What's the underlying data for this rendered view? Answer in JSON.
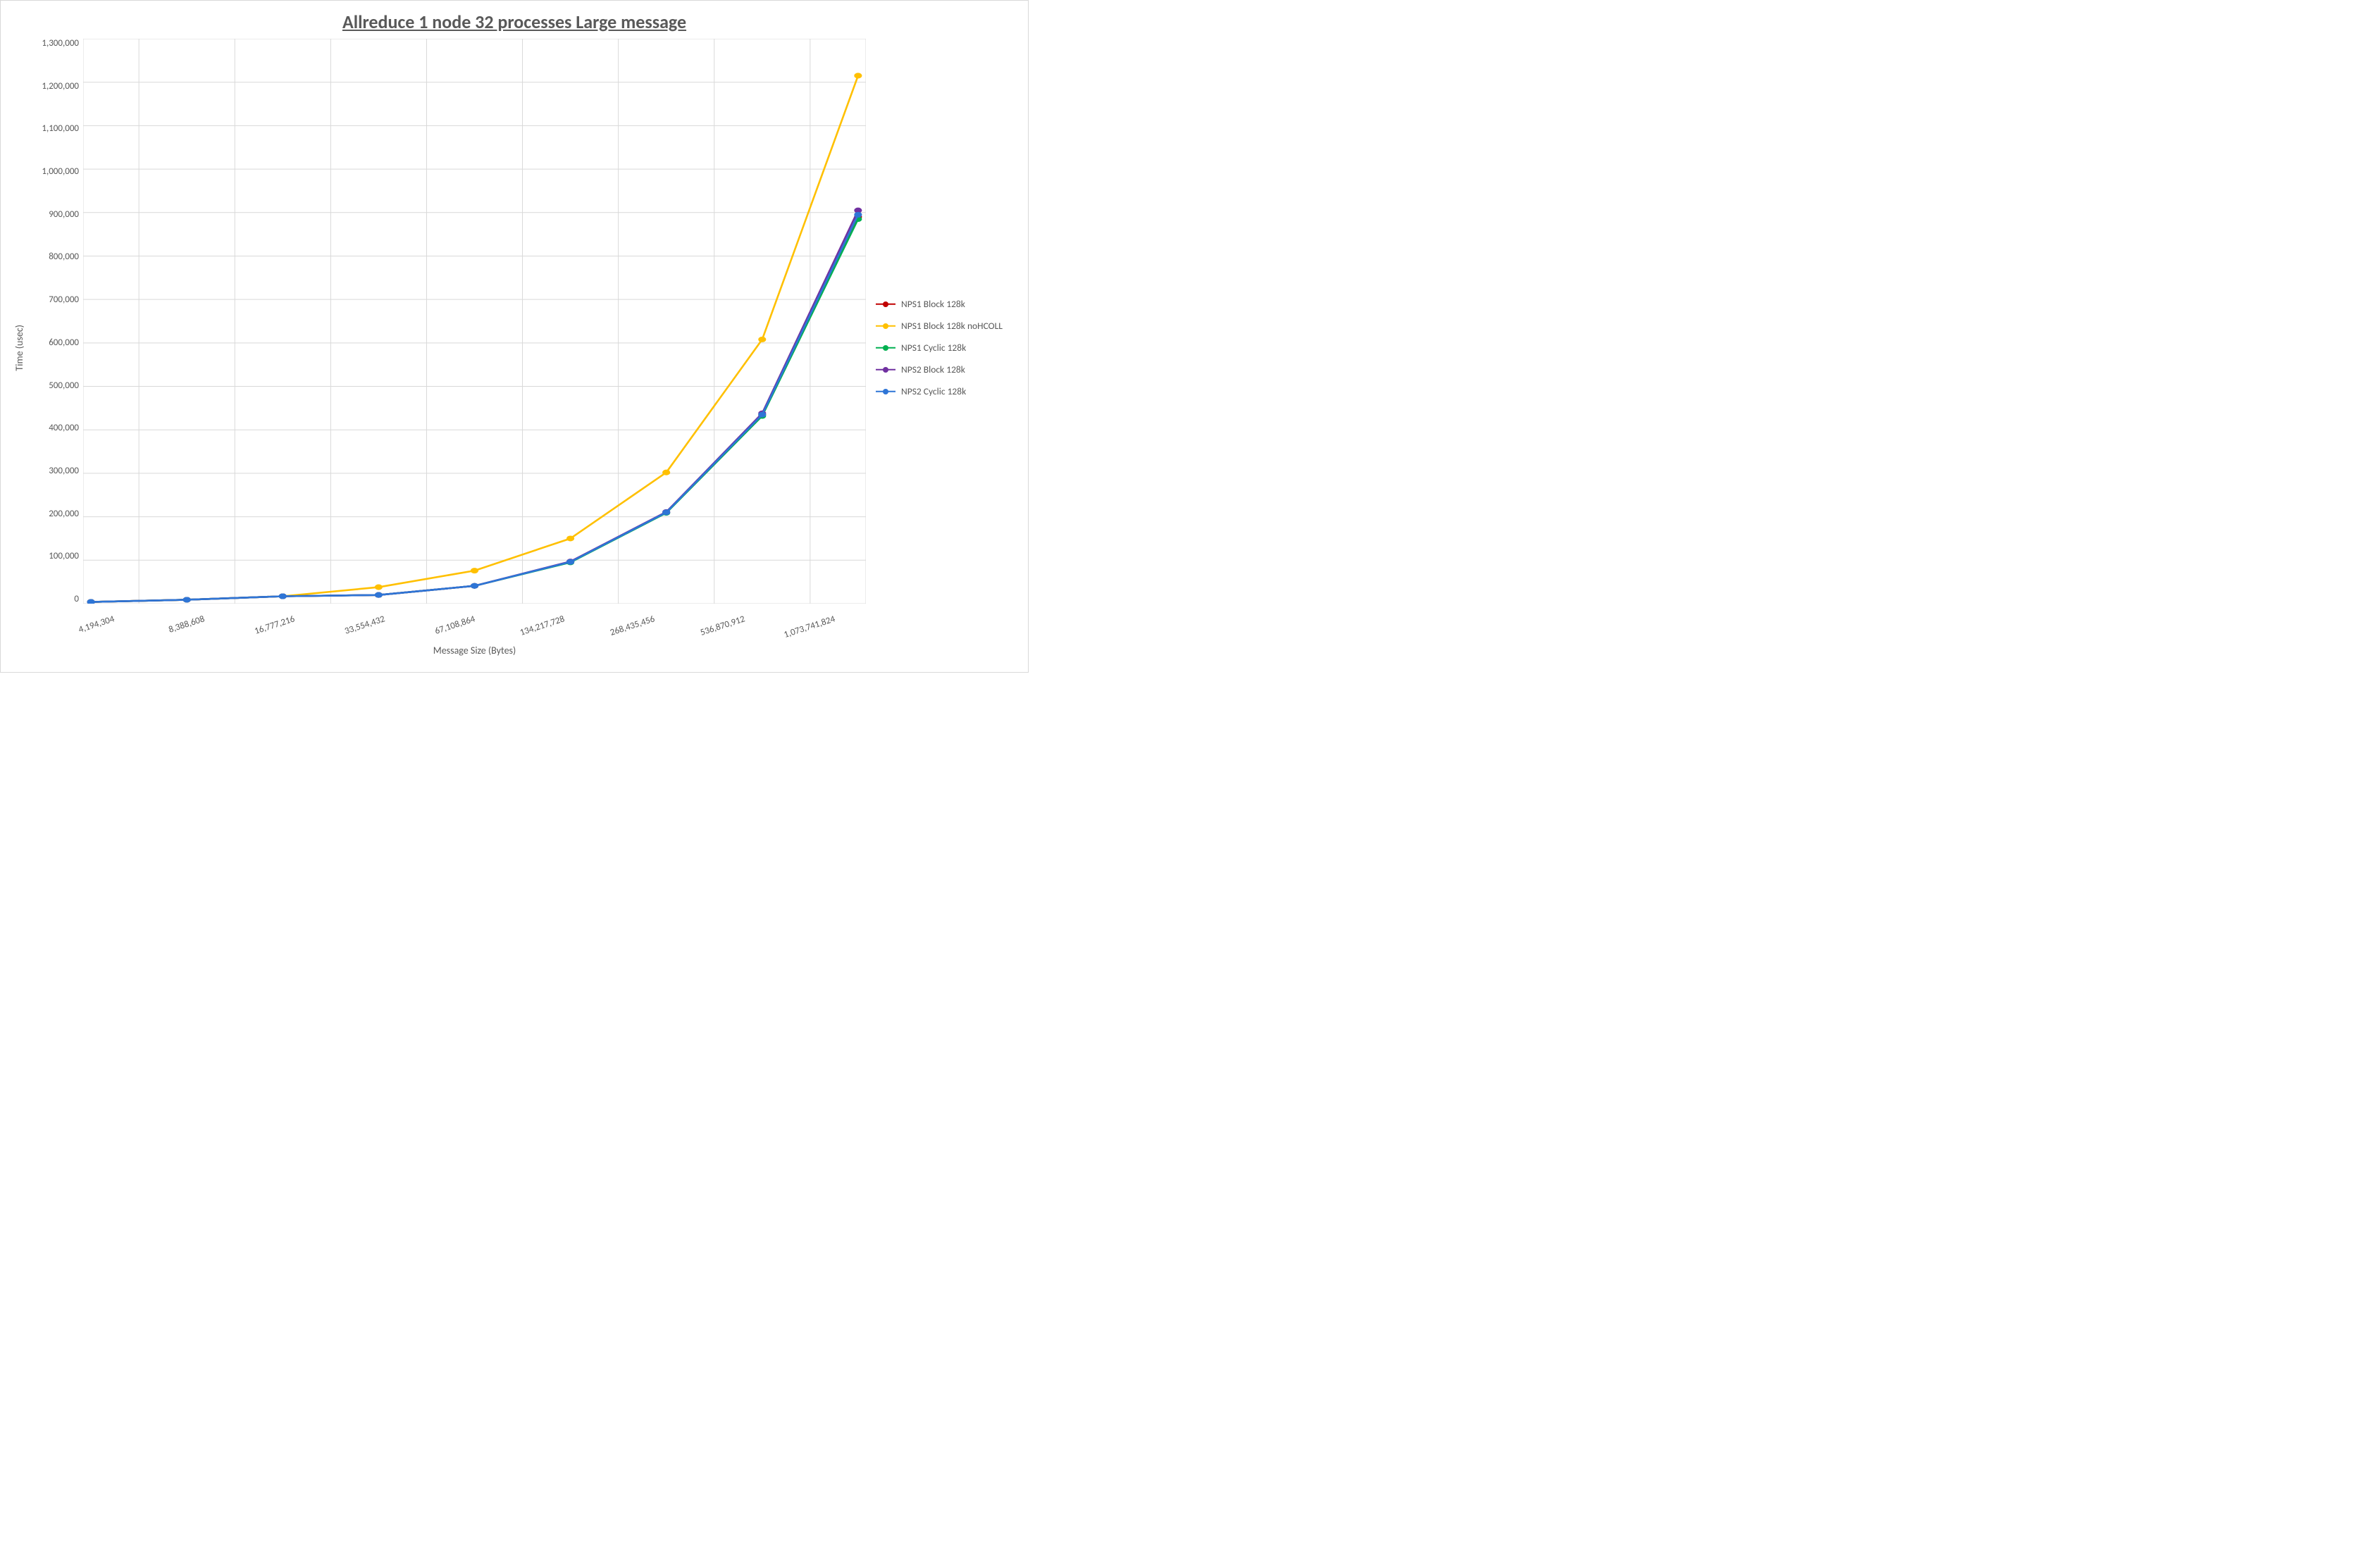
{
  "chart_data": {
    "type": "line",
    "title": "Allreduce 1 node 32 processes Large message",
    "xlabel": "Message Size (Bytes)",
    "ylabel": "Time (usec)",
    "ylim": [
      0,
      1300000
    ],
    "y_ticks": [
      "1,300,000",
      "1,200,000",
      "1,100,000",
      "1,000,000",
      "900,000",
      "800,000",
      "700,000",
      "600,000",
      "500,000",
      "400,000",
      "300,000",
      "200,000",
      "100,000",
      "0"
    ],
    "categories": [
      "4,194,304",
      "8,388,608",
      "16,777,216",
      "33,554,432",
      "67,108,864",
      "134,217,728",
      "268,435,456",
      "536,870,912",
      "1,073,741,824"
    ],
    "series": [
      {
        "name": "NPS1 Block 128k",
        "color": "#C00000",
        "values": [
          4000,
          9000,
          17000,
          20000,
          41000,
          96000,
          210000,
          435000,
          890000
        ]
      },
      {
        "name": "NPS1 Block 128k noHCOLL",
        "color": "#FFC000",
        "values": [
          4000,
          9000,
          17000,
          38000,
          76000,
          150000,
          302000,
          608000,
          1215000
        ]
      },
      {
        "name": "NPS1 Cyclic 128k",
        "color": "#00B050",
        "values": [
          4000,
          9000,
          17000,
          20000,
          41000,
          95000,
          209000,
          432000,
          885000
        ]
      },
      {
        "name": "NPS2 Block 128k",
        "color": "#7030A0",
        "values": [
          4000,
          9000,
          17000,
          20000,
          41000,
          97000,
          211000,
          438000,
          905000
        ]
      },
      {
        "name": "NPS2 Cyclic 128k",
        "color": "#2E75D6",
        "values": [
          4000,
          9000,
          17000,
          20000,
          41000,
          96000,
          210000,
          435000,
          895000
        ]
      }
    ]
  }
}
